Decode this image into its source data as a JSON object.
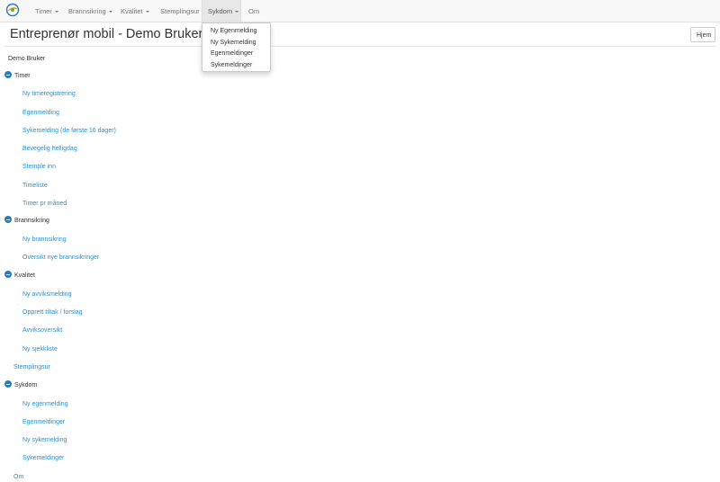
{
  "navbar": {
    "items": [
      {
        "label": "Timer",
        "dropdown": true
      },
      {
        "label": "Brannsikring",
        "dropdown": true
      },
      {
        "label": "Kvalitet",
        "dropdown": true
      },
      {
        "label": "Stemplingsur",
        "dropdown": false
      },
      {
        "label": "Sykdom",
        "dropdown": true,
        "active": true
      },
      {
        "label": "Om",
        "dropdown": false
      }
    ],
    "dropdown": {
      "items": [
        "Ny Egenmelding",
        "Ny Sykemelding",
        "Egenmeldinger",
        "Sykemeldinger"
      ]
    }
  },
  "header": {
    "title": "Entreprenør mobil - Demo Bruker",
    "home_label": "Hjem"
  },
  "tree": {
    "root": "Demo Bruker",
    "timer": {
      "label": "Timer",
      "items": [
        "Ny timeregistrering",
        "Egenmelding",
        "Sykemelding (de første 16 dager)",
        "Bevegelig helligdag",
        "Stemple inn",
        "Timeliste",
        "Timer pr måned"
      ]
    },
    "brannsikring": {
      "label": "Brannsikring",
      "items": [
        "Ny brannsikring",
        "Oversikt nye brannsikringer"
      ]
    },
    "kvalitet": {
      "label": "Kvalitet",
      "items": [
        "Ny avviksmelding",
        "Opprett tiltak / forslag",
        "Avviksoversikt",
        "Ny sjekkliste"
      ]
    },
    "stemplingsur": "Stemplingsur",
    "sykdom": {
      "label": "Sykdom",
      "items": [
        "Ny egenmelding",
        "Egenmeldinger",
        "Ny sykemelding",
        "Sykemeldinger"
      ]
    },
    "om": "Om"
  },
  "colors": {
    "link": "#2a90cf",
    "toggle": "#2b7bba",
    "navbar_bg": "#f8f8f8"
  }
}
